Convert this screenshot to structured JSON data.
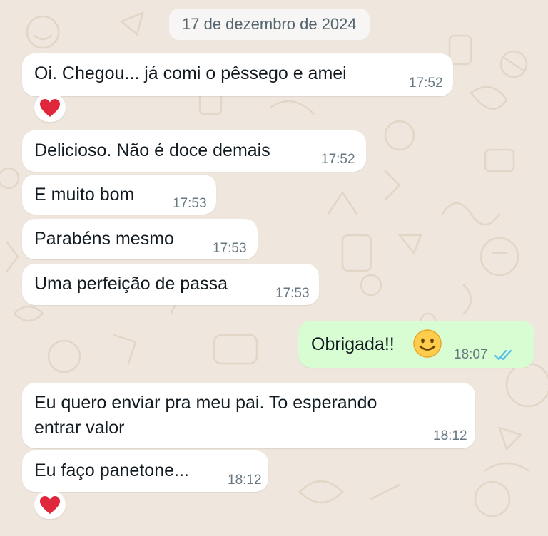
{
  "date_separator": "17 de dezembro de 2024",
  "messages": [
    {
      "text": "Oi. Chegou... já comi o pêssego e amei",
      "time": "17:52",
      "direction": "in",
      "reaction": "red-heart"
    },
    {
      "text": "Delicioso. Não é doce demais",
      "time": "17:52",
      "direction": "in"
    },
    {
      "text": "E muito bom",
      "time": "17:53",
      "direction": "in"
    },
    {
      "text": "Parabéns mesmo",
      "time": "17:53",
      "direction": "in"
    },
    {
      "text": "Uma perfeição de passa",
      "time": "17:53",
      "direction": "in"
    },
    {
      "text": "Obrigada!!",
      "time": "18:07",
      "direction": "out",
      "emoji": "smiling-face",
      "status": "read"
    },
    {
      "text_line1": "Eu quero enviar pra meu pai. To esperando",
      "text_line2": "entrar valor",
      "time": "18:12",
      "direction": "in"
    },
    {
      "text": "Eu faço panetone...",
      "time": "18:12",
      "direction": "in",
      "reaction": "red-heart"
    }
  ],
  "colors": {
    "wallpaper": "#efe7dd",
    "incoming_bubble": "#ffffff",
    "outgoing_bubble": "#d9fdd3",
    "read_ticks": "#53bdeb",
    "heart": "#e0263b"
  }
}
